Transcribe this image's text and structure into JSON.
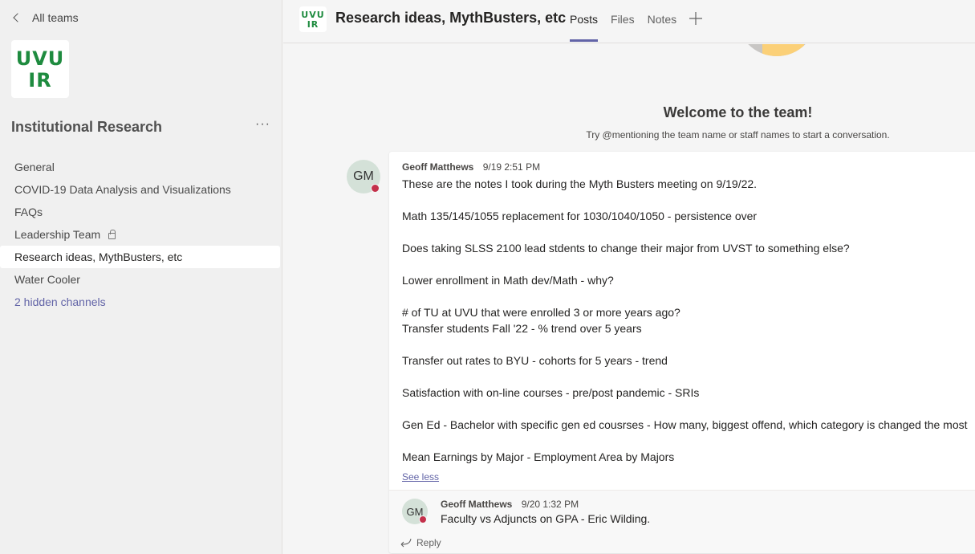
{
  "sidebar": {
    "back_label": "All teams",
    "team_logo": {
      "line1": "UVU",
      "line2": "IR"
    },
    "team_name": "Institutional Research",
    "more_icon": "ellipsis-icon",
    "channels": [
      {
        "label": "General",
        "active": false
      },
      {
        "label": "COVID-19 Data Analysis and Visualizations",
        "active": false
      },
      {
        "label": "FAQs",
        "active": false
      },
      {
        "label": "Leadership Team",
        "active": false,
        "private": true
      },
      {
        "label": "Research ideas, MythBusters, etc",
        "active": true
      },
      {
        "label": "Water Cooler",
        "active": false
      }
    ],
    "hidden_channels_label": "2 hidden channels"
  },
  "header": {
    "logo": {
      "line1": "UVU",
      "line2": "IR"
    },
    "title": "Research ideas, MythBusters, etc",
    "tabs": [
      {
        "label": "Posts",
        "active": true
      },
      {
        "label": "Files",
        "active": false
      },
      {
        "label": "Notes",
        "active": false
      }
    ],
    "add_tab_icon": "plus-icon"
  },
  "welcome": {
    "title": "Welcome to the team!",
    "subtitle": "Try @mentioning the team name or staff names to start a conversation."
  },
  "post": {
    "author": "Geoff Matthews",
    "initials": "GM",
    "timestamp": "9/19 2:51 PM",
    "presence": "busy",
    "lines": [
      "These are the notes I took during the Myth Busters meeting on 9/19/22.",
      "",
      "Math 135/145/1055 replacement for 1030/1040/1050 - persistence over",
      "",
      "Does taking SLSS 2100 lead stdents to change their major from UVST to something else?",
      "",
      "Lower enrollment in Math dev/Math - why?",
      "",
      "# of TU at UVU that were enrolled 3 or more years ago?",
      "Transfer students Fall '22 - % trend over 5 years",
      "",
      "Transfer out rates to BYU - cohorts for 5 years - trend",
      "",
      "Satisfaction with on-line courses - pre/post pandemic - SRIs",
      "",
      "Gen Ed - Bachelor with specific gen ed cousrses - How many, biggest offend, which category is changed the most",
      "",
      "Mean Earnings by Major - Employment Area by Majors"
    ],
    "see_less_label": "See less",
    "reply": {
      "author": "Geoff Matthews",
      "initials": "GM",
      "timestamp": "9/20 1:32 PM",
      "text": "Faculty vs Adjuncts on GPA - Eric Wilding."
    },
    "reply_button_label": "Reply"
  },
  "colors": {
    "accent": "#6264a7",
    "logo_green": "#1e8b3f",
    "presence_busy": "#c4314b"
  }
}
